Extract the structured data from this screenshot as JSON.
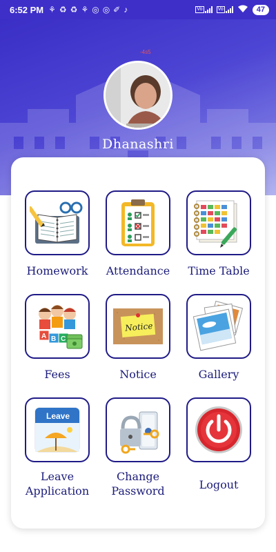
{
  "status_bar": {
    "time": "6:52 PM",
    "battery": "47",
    "left_icons": [
      "notification-icon",
      "sync-icon",
      "sync-icon",
      "notification-icon",
      "whatsapp-icon",
      "viber-icon",
      "app-icon",
      "tiktok-icon"
    ],
    "right_icons": [
      "volte-signal-icon",
      "volte-signal-icon",
      "wifi-icon",
      "battery-icon"
    ]
  },
  "header": {
    "background_color": "#3e2fc9",
    "tag": "-4s5",
    "profile_name": "Dhanashri"
  },
  "menu": {
    "items": [
      {
        "label": "Homework",
        "icon": "homework-icon"
      },
      {
        "label": "Attendance",
        "icon": "attendance-icon"
      },
      {
        "label": "Time Table",
        "icon": "timetable-icon"
      },
      {
        "label": "Fees",
        "icon": "fees-icon"
      },
      {
        "label": "Notice",
        "icon": "notice-icon"
      },
      {
        "label": "Gallery",
        "icon": "gallery-icon"
      },
      {
        "label": "Leave Application",
        "icon": "leave-icon",
        "line1": "Leave",
        "line2": "Application"
      },
      {
        "label": "Change Password",
        "icon": "password-icon",
        "line1": "Change",
        "line2": "Password"
      },
      {
        "label": "Logout",
        "icon": "logout-icon"
      }
    ],
    "leave_icon_text": "Leave",
    "notice_icon_text": "Notice"
  }
}
